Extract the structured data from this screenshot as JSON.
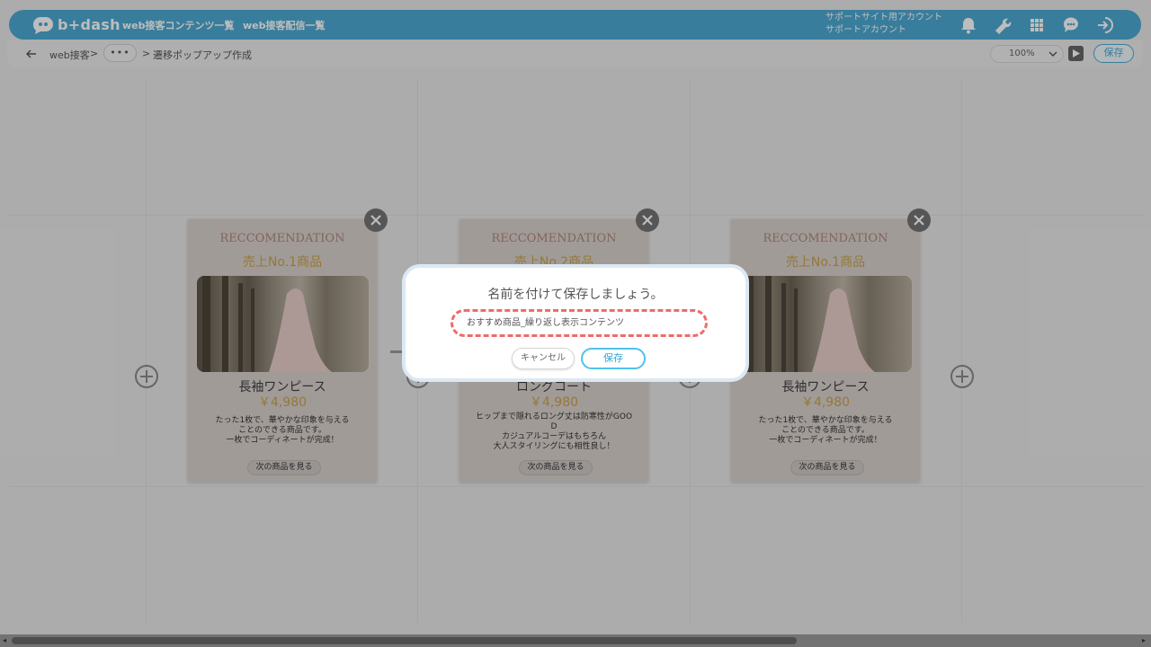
{
  "app": {
    "logo_text": "b+dash"
  },
  "nav": {
    "link1": "web接客コンテンツ一覧",
    "link2": "web接客配信一覧"
  },
  "account": {
    "line1": "サポートサイト用アカウント",
    "line2": "サポートアカウント"
  },
  "icons": [
    "bell-icon",
    "wrench-icon",
    "grid-icon",
    "chat-icon",
    "logout-icon"
  ],
  "breadcrumb": {
    "root": "web接客",
    "sep1": ">",
    "more": "•••",
    "sep2": ">",
    "current": "遷移ポップアップ作成"
  },
  "toolbar": {
    "zoom": "100%",
    "save_label": "保存"
  },
  "cards": [
    {
      "heading": "RECCOMENDATION",
      "sub": "売上No.1商品",
      "title": "長袖ワンピース",
      "price": "￥4,980",
      "desc": "たった1枚で、華やかな印象を与える\nことのできる商品です。\n一枚でコーディネートが完成！",
      "button": "次の商品を見る"
    },
    {
      "heading": "RECCOMENDATION",
      "sub": "売上No.2商品",
      "title": "ロングコート",
      "price": "￥4,980",
      "desc": "ヒップまで隠れるロング丈は防寒性がGOO\nD\nカジュアルコーデはもちろん\n大人スタイリングにも相性良し！",
      "button": "次の商品を見る"
    },
    {
      "heading": "RECCOMENDATION",
      "sub": "売上No.1商品",
      "title": "長袖ワンピース",
      "price": "￥4,980",
      "desc": "たった1枚で、華やかな印象を与える\nことのできる商品です。\n一枚でコーディネートが完成！",
      "button": "次の商品を見る"
    }
  ],
  "modal": {
    "title": "名前を付けて保存しましょう。",
    "input_value": "おすすめ商品_繰り返し表示コンテンツ",
    "cancel_label": "キャンセル",
    "save_label": "保存"
  },
  "colors": {
    "brand": "#4da9d3",
    "highlight": "#ef6b6b",
    "gold": "#c9a248"
  }
}
